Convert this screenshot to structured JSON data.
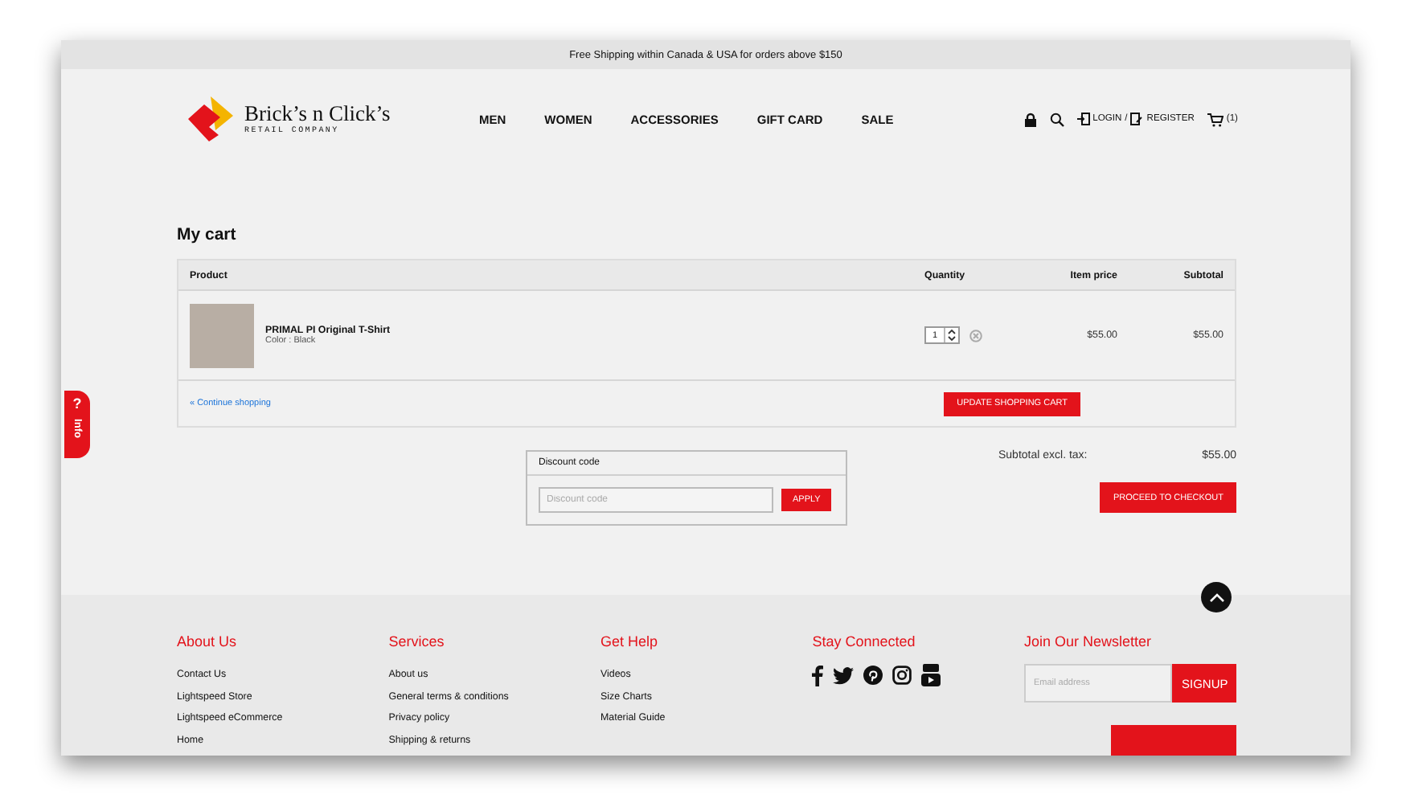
{
  "announcement": "Free Shipping within Canada & USA for orders above $150",
  "logo": {
    "name": "Brick’s n Click’s",
    "tagline": "RETAIL COMPANY"
  },
  "nav": [
    {
      "label": "MEN"
    },
    {
      "label": "WOMEN"
    },
    {
      "label": "ACCESSORIES"
    },
    {
      "label": "GIFT CARD"
    },
    {
      "label": "SALE"
    }
  ],
  "account": {
    "login": "LOGIN",
    "separator": "/",
    "register": "REGISTER",
    "cart_count": "(1)"
  },
  "info_tab": {
    "icon": "?",
    "label": "Info"
  },
  "cart": {
    "title": "My cart",
    "columns": [
      "Product",
      "Quantity",
      "Item price",
      "Subtotal"
    ],
    "rows": [
      {
        "name": "PRIMAL PI Original T-Shirt",
        "variant": "Color : Black",
        "quantity": "1",
        "price": "$55.00",
        "subtotal": "$55.00"
      }
    ],
    "continue": "« Continue shopping",
    "update_button": "UPDATE SHOPPING CART"
  },
  "discount": {
    "title": "Discount code",
    "placeholder": "Discount code",
    "button": "APPLY"
  },
  "summary": {
    "label": "Subtotal excl. tax:",
    "value": "$55.00",
    "checkout": "PROCEED TO CHECKOUT"
  },
  "footer": {
    "columns": [
      {
        "kind": "links",
        "title": "About Us",
        "links": [
          "Contact Us",
          "Lightspeed Store",
          "Lightspeed eCommerce",
          "Home"
        ]
      },
      {
        "kind": "links",
        "title": "Services",
        "links": [
          "About us",
          "General terms & conditions",
          "Privacy policy",
          "Shipping & returns"
        ]
      },
      {
        "kind": "links",
        "title": "Get Help",
        "links": [
          "Videos",
          "Size Charts",
          "Material Guide"
        ]
      },
      {
        "kind": "social",
        "title": "Stay Connected"
      },
      {
        "kind": "newsletter",
        "title": "Join Our Newsletter",
        "placeholder": "Email address",
        "button": "SIGNUP"
      }
    ]
  }
}
